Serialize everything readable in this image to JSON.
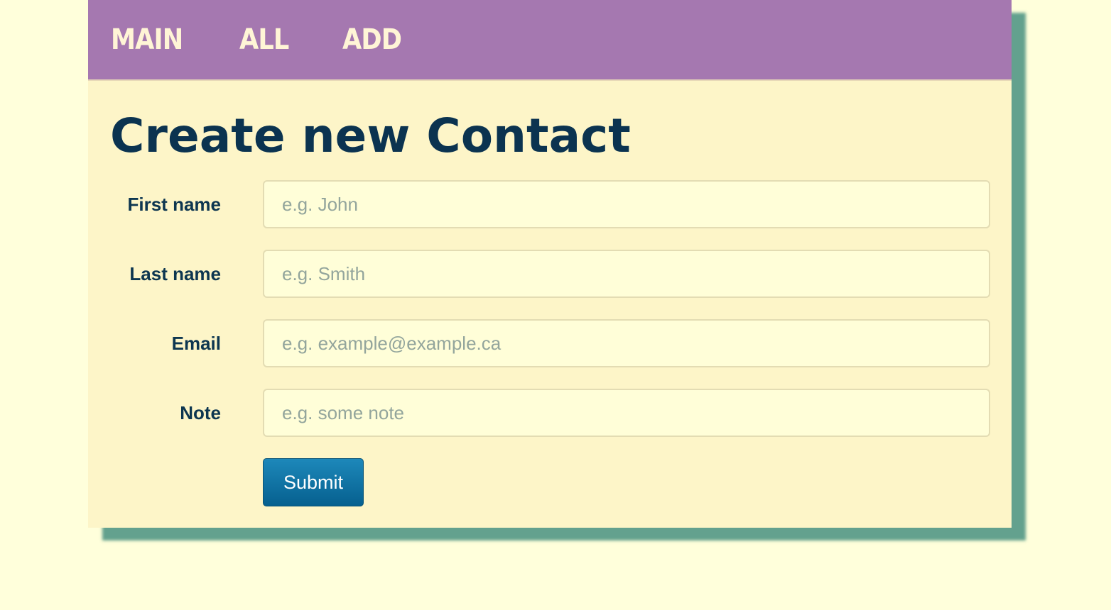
{
  "nav": {
    "items": [
      {
        "label": "MAIN"
      },
      {
        "label": "ALL"
      },
      {
        "label": "ADD"
      }
    ]
  },
  "page": {
    "title": "Create new Contact"
  },
  "form": {
    "first_name": {
      "label": "First name",
      "placeholder": "e.g. John",
      "value": ""
    },
    "last_name": {
      "label": "Last name",
      "placeholder": "e.g. Smith",
      "value": ""
    },
    "email": {
      "label": "Email",
      "placeholder": "e.g. example@example.ca",
      "value": ""
    },
    "note": {
      "label": "Note",
      "placeholder": "e.g. some note",
      "value": ""
    },
    "submit_label": "Submit"
  },
  "colors": {
    "page_background": "#ffffdb",
    "card_background": "#fdf5c8",
    "navbar": "#a578b0",
    "shadow": "#489180",
    "title_text": "#0b3350",
    "button": "#06608f"
  }
}
